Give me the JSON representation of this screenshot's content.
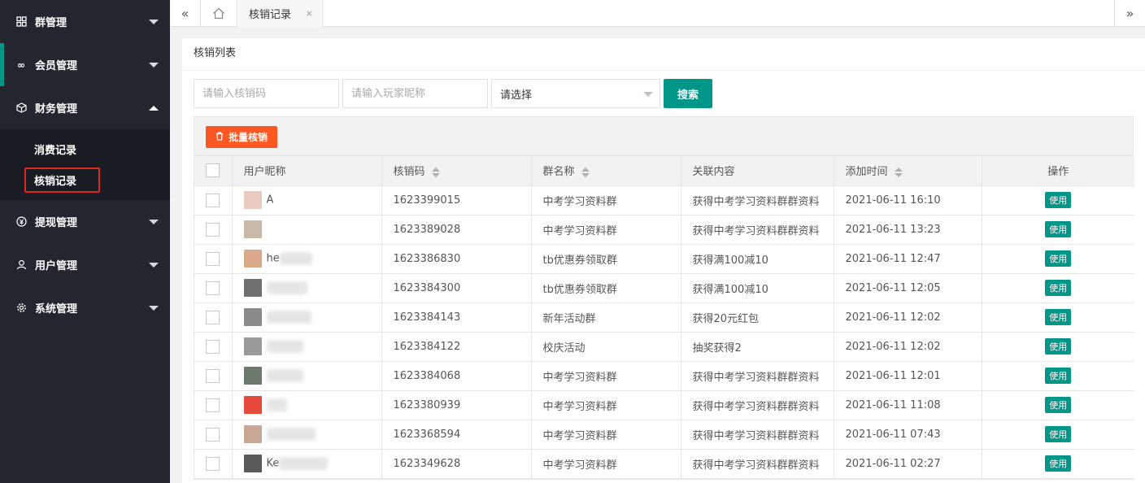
{
  "sidebar": {
    "items": [
      {
        "label": "群管理",
        "icon": "grid-icon"
      },
      {
        "label": "会员管理",
        "icon": "infinity-icon"
      },
      {
        "label": "财务管理",
        "icon": "cube-icon"
      },
      {
        "label": "提现管理",
        "icon": "yen-icon"
      },
      {
        "label": "用户管理",
        "icon": "user-icon"
      },
      {
        "label": "系统管理",
        "icon": "gear-icon"
      }
    ],
    "sub_items": [
      "消费记录",
      "核销记录"
    ],
    "accent_color": "#009688",
    "highlight_color": "#e0261f"
  },
  "topbar": {
    "tab_label": "核销记录",
    "close_symbol": "×"
  },
  "card": {
    "title": "核销列表"
  },
  "filter": {
    "code_placeholder": "请输入核销码",
    "nick_placeholder": "请输入玩家昵称",
    "select_value": "请选择",
    "search_label": "搜索"
  },
  "toolbar": {
    "batch_label": "批量核销"
  },
  "table": {
    "headers": [
      "用户昵称",
      "核销码",
      "群名称",
      "关联内容",
      "添加时间",
      "操作"
    ],
    "rows": [
      {
        "nick": "A",
        "avatar": "#e9c9c0",
        "blur": 0,
        "code": "1623399015",
        "group": "中考学习资料群",
        "content": "获得中考学习资料群群资料",
        "time": "2021-06-11 16:10",
        "action": "使用"
      },
      {
        "nick": "",
        "avatar": "#c8b8a8",
        "blur": 0,
        "code": "1623389028",
        "group": "中考学习资料群",
        "content": "获得中考学习资料群群资料",
        "time": "2021-06-11 13:23",
        "action": "使用"
      },
      {
        "nick": "he",
        "avatar": "#d9a98a",
        "blur": 40,
        "code": "1623386830",
        "group": "tb优惠券领取群",
        "content": "获得满100减10",
        "time": "2021-06-11 12:47",
        "action": "使用"
      },
      {
        "nick": "",
        "avatar": "#707070",
        "blur": 50,
        "code": "1623384300",
        "group": "tb优惠券领取群",
        "content": "获得满100减10",
        "time": "2021-06-11 12:05",
        "action": "使用"
      },
      {
        "nick": "",
        "avatar": "#8a8a8a",
        "blur": 55,
        "code": "1623384143",
        "group": "新年活动群",
        "content": "获得20元红包",
        "time": "2021-06-11 12:02",
        "action": "使用"
      },
      {
        "nick": "",
        "avatar": "#9a9a9a",
        "blur": 45,
        "code": "1623384122",
        "group": "校庆活动",
        "content": "抽奖获得2",
        "time": "2021-06-11 12:02",
        "action": "使用"
      },
      {
        "nick": "",
        "avatar": "#6f7a6f",
        "blur": 45,
        "code": "1623384068",
        "group": "中考学习资料群",
        "content": "获得中考学习资料群群资料",
        "time": "2021-06-11 12:01",
        "action": "使用"
      },
      {
        "nick": "",
        "avatar": "#e64a3b",
        "blur": 25,
        "code": "1623380939",
        "group": "中考学习资料群",
        "content": "获得中考学习资料群群资料",
        "time": "2021-06-11 11:08",
        "action": "使用"
      },
      {
        "nick": "",
        "avatar": "#c9a898",
        "blur": 60,
        "code": "1623368594",
        "group": "中考学习资料群",
        "content": "获得中考学习资料群群资料",
        "time": "2021-06-11 07:43",
        "action": "使用"
      },
      {
        "nick": "Ke",
        "avatar": "#5a5a5a",
        "blur": 60,
        "code": "1623349628",
        "group": "中考学习资料群",
        "content": "获得中考学习资料群群资料",
        "time": "2021-06-11 02:27",
        "action": "使用"
      }
    ]
  }
}
